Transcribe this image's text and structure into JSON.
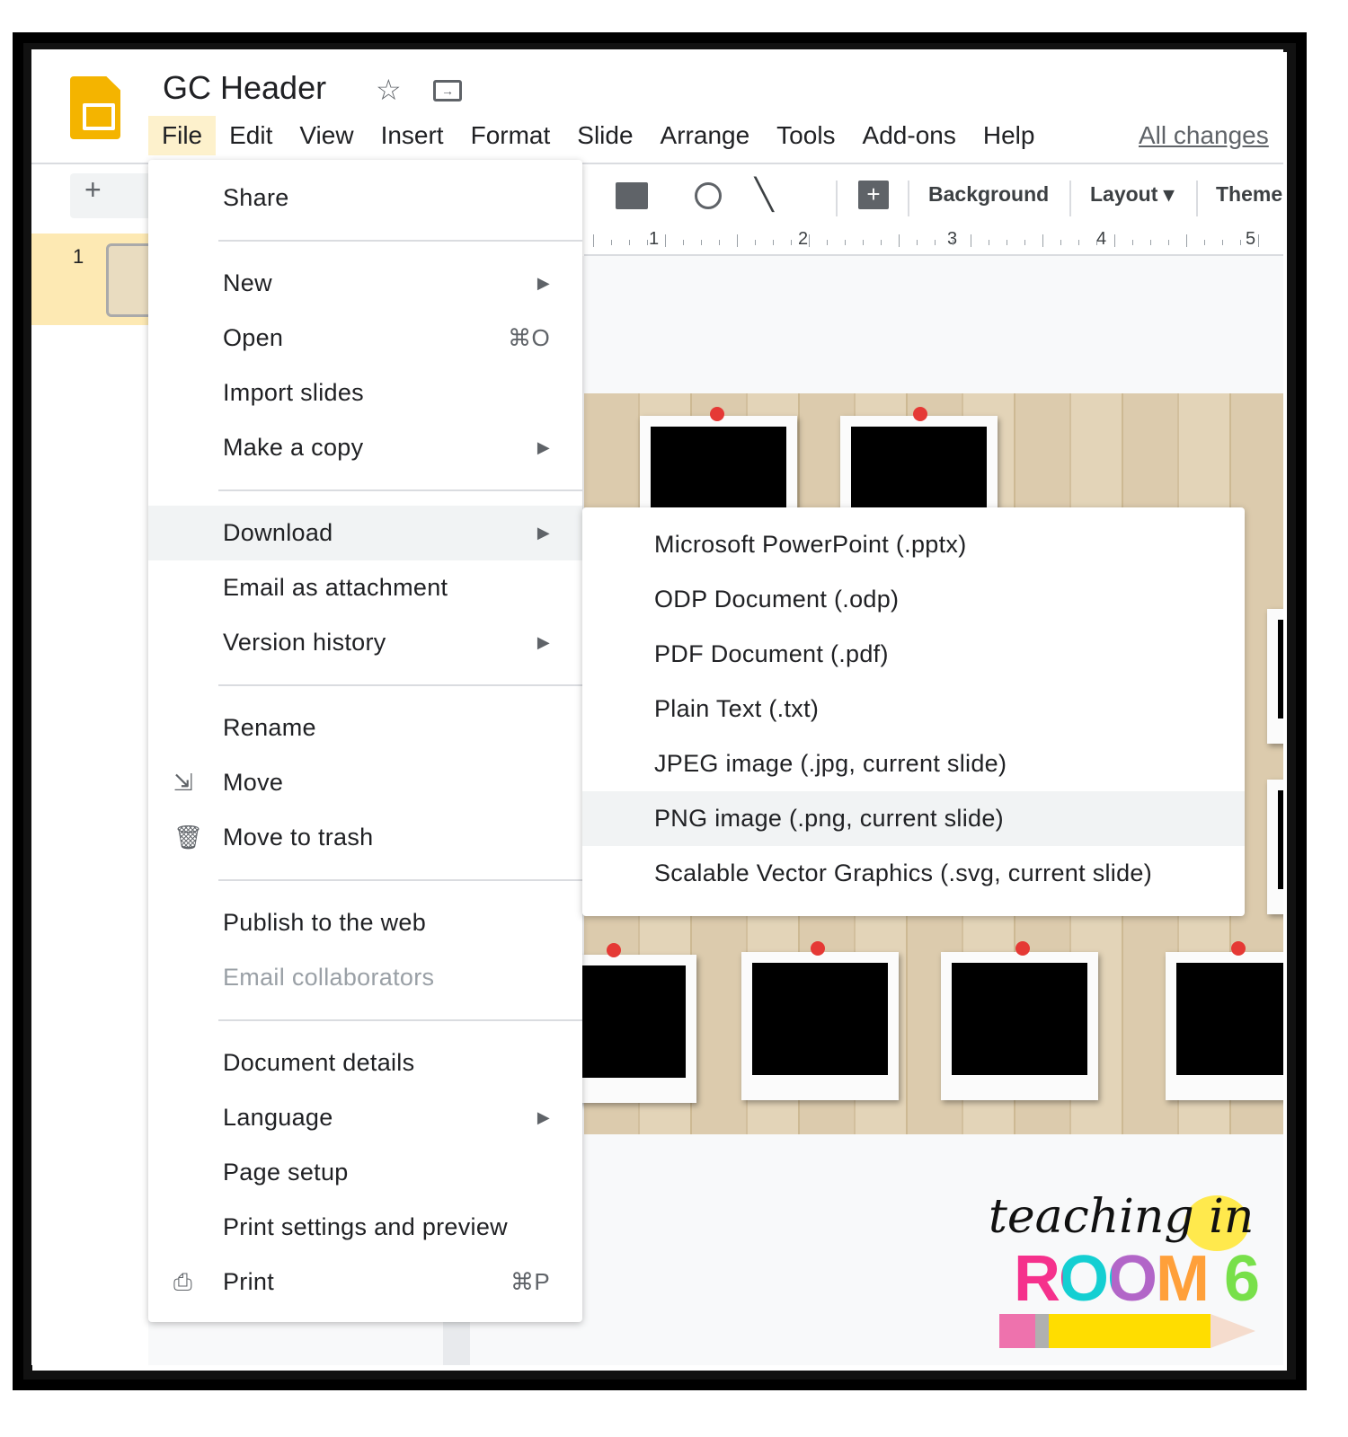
{
  "doc": {
    "title": "GC Header",
    "status": "All changes"
  },
  "menubar": [
    "File",
    "Edit",
    "View",
    "Insert",
    "Format",
    "Slide",
    "Arrange",
    "Tools",
    "Add-ons",
    "Help"
  ],
  "toolbar": {
    "background": "Background",
    "layout": "Layout",
    "theme": "Theme"
  },
  "ruler": [
    "1",
    "2",
    "3",
    "4",
    "5"
  ],
  "filmstrip": {
    "slide_number": "1"
  },
  "file_menu": [
    {
      "label": "Share"
    },
    {
      "sep": true
    },
    {
      "label": "New",
      "submenu": true
    },
    {
      "label": "Open",
      "shortcut": "⌘O"
    },
    {
      "label": "Import slides"
    },
    {
      "label": "Make a copy",
      "submenu": true
    },
    {
      "sep": true
    },
    {
      "label": "Download",
      "submenu": true,
      "highlighted": true
    },
    {
      "label": "Email as attachment"
    },
    {
      "label": "Version history",
      "submenu": true
    },
    {
      "sep": true
    },
    {
      "label": "Rename"
    },
    {
      "label": "Move",
      "icon": "folder-move-icon"
    },
    {
      "label": "Move to trash",
      "icon": "trash-icon"
    },
    {
      "sep": true
    },
    {
      "label": "Publish to the web"
    },
    {
      "label": "Email collaborators",
      "disabled": true
    },
    {
      "sep": true
    },
    {
      "label": "Document details"
    },
    {
      "label": "Language",
      "submenu": true
    },
    {
      "label": "Page setup"
    },
    {
      "label": "Print settings and preview"
    },
    {
      "label": "Print",
      "shortcut": "⌘P",
      "icon": "printer-icon"
    }
  ],
  "download_menu": [
    {
      "label": "Microsoft PowerPoint (.pptx)"
    },
    {
      "label": "ODP Document (.odp)"
    },
    {
      "label": "PDF Document (.pdf)"
    },
    {
      "label": "Plain Text (.txt)"
    },
    {
      "label": "JPEG image (.jpg, current slide)"
    },
    {
      "label": "PNG image (.png, current slide)",
      "highlighted": true
    },
    {
      "label": "Scalable Vector Graphics (.svg, current slide)"
    }
  ],
  "brand": {
    "line1": "teaching in",
    "line2": "ROOM 6"
  },
  "colors": {
    "accent": "#f4b400",
    "highlight": "#fdf1cc",
    "menu_hover": "#f1f3f4"
  }
}
